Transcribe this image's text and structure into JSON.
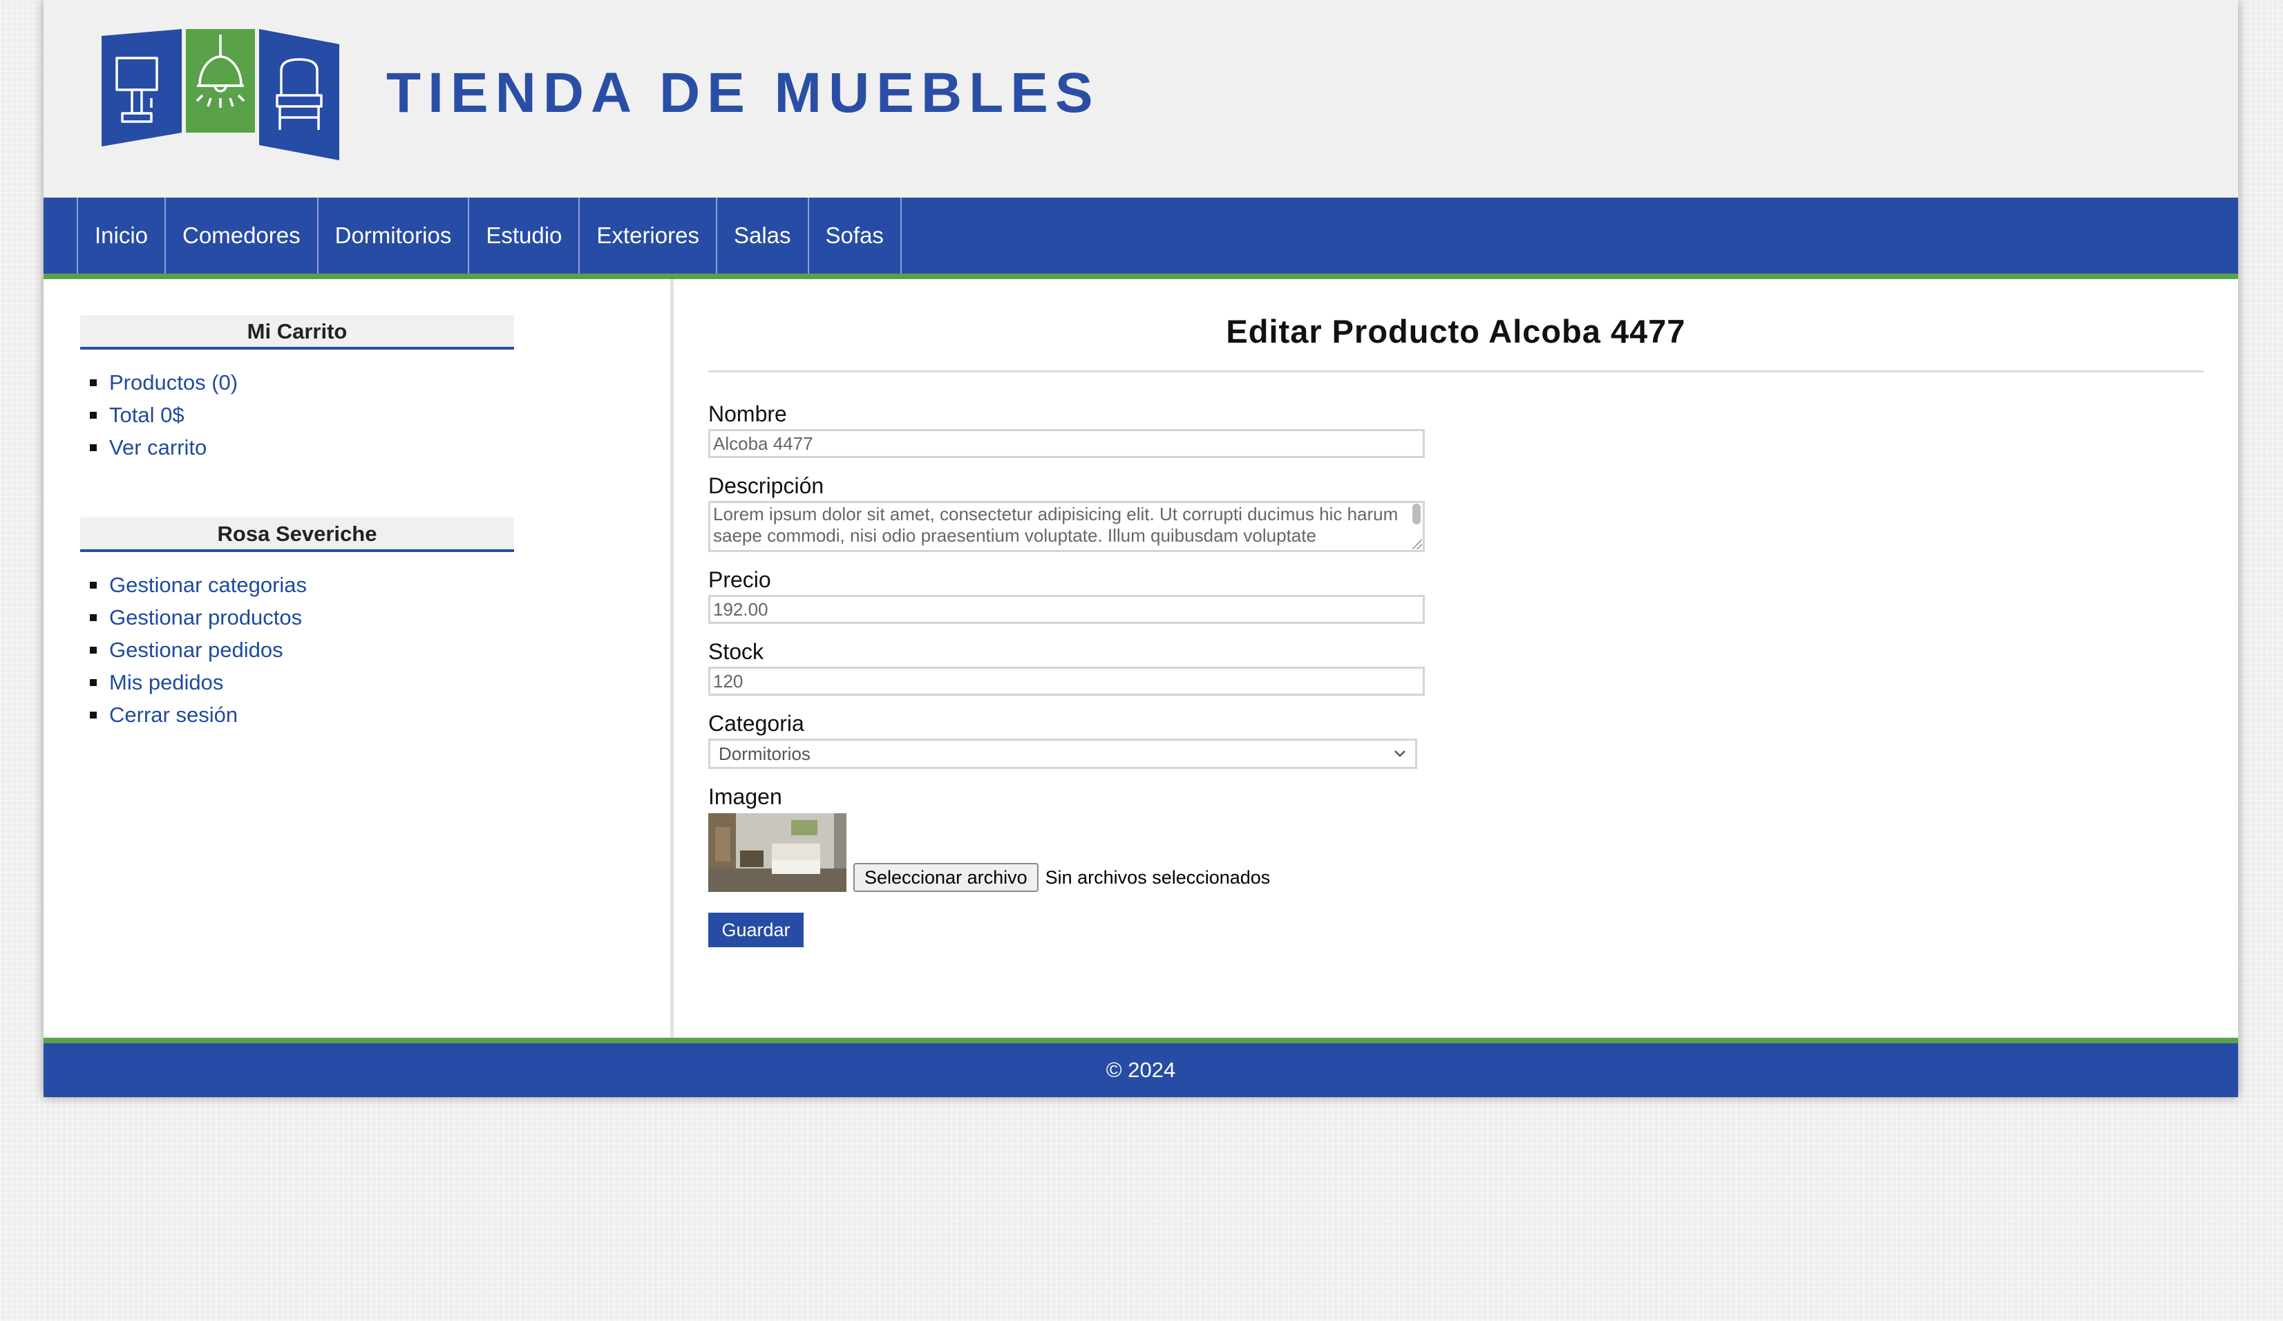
{
  "header": {
    "site_title": "TIENDA DE MUEBLES"
  },
  "nav": {
    "items": [
      "Inicio",
      "Comedores",
      "Dormitorios",
      "Estudio",
      "Exteriores",
      "Salas",
      "Sofas"
    ]
  },
  "sidebar": {
    "cart": {
      "title": "Mi Carrito",
      "items": [
        "Productos (0)",
        "Total 0$",
        "Ver carrito"
      ]
    },
    "user": {
      "title": "Rosa Severiche",
      "items": [
        "Gestionar categorias",
        "Gestionar productos",
        "Gestionar pedidos",
        "Mis pedidos",
        "Cerrar sesión"
      ]
    }
  },
  "main": {
    "title": "Editar Producto Alcoba 4477",
    "form": {
      "name_label": "Nombre",
      "name_value": "Alcoba 4477",
      "description_label": "Descripción",
      "description_value": "Lorem ipsum dolor sit amet, consectetur adipisicing elit. Ut corrupti ducimus hic harum saepe commodi, nisi odio praesentium voluptate. Illum quibusdam voluptate",
      "price_label": "Precio",
      "price_value": "192.00",
      "stock_label": "Stock",
      "stock_value": "120",
      "category_label": "Categoria",
      "category_value": "Dormitorios",
      "image_label": "Imagen",
      "file_button_label": "Seleccionar archivo",
      "file_status": "Sin archivos seleccionados",
      "save_label": "Guardar"
    }
  },
  "footer": {
    "text": "© 2024"
  },
  "colors": {
    "brand_blue": "#274ca5",
    "accent_green": "#59a24a",
    "link_blue": "#1f4aa0"
  }
}
